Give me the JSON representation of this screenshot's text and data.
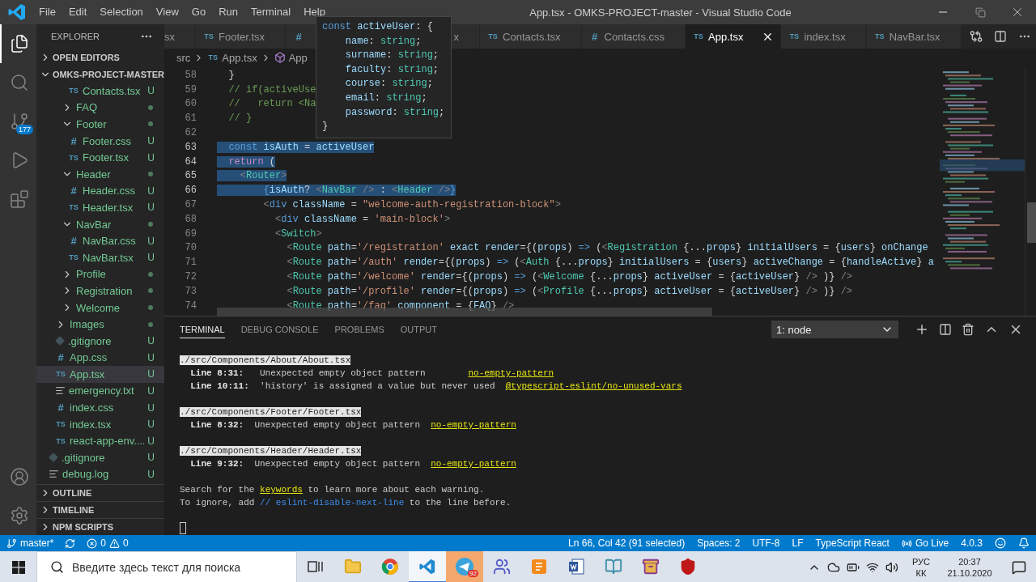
{
  "title_bar": {
    "menu": [
      "File",
      "Edit",
      "Selection",
      "View",
      "Go",
      "Run",
      "Terminal",
      "Help"
    ],
    "title": "App.tsx - OMKS-PROJECT-master - Visual Studio Code"
  },
  "activity_bar": {
    "items": [
      {
        "kind": "explorer",
        "selected": true
      },
      {
        "kind": "search",
        "selected": false
      },
      {
        "kind": "source-control",
        "selected": false,
        "badge": "177"
      },
      {
        "kind": "run",
        "selected": false
      },
      {
        "kind": "extensions",
        "selected": false
      }
    ],
    "bottom": [
      {
        "kind": "account"
      },
      {
        "kind": "settings"
      }
    ]
  },
  "explorer": {
    "title": "EXPLORER",
    "sections_top": [
      {
        "label": "OPEN EDITORS",
        "expanded": false
      },
      {
        "label": "OMKS-PROJECT-MASTER",
        "expanded": true
      }
    ],
    "tree": [
      {
        "children": [
          {
            "children": [
              {
                "children": [
                  {
                    "kind": "ts",
                    "glyph": "TS",
                    "label": "Contacts.tsx",
                    "badge": "U",
                    "selected": false
                  }
                ]
              },
              {
                "kind": "folder",
                "label": "FAQ",
                "expanded": false,
                "modified": true,
                "selected": false
              },
              {
                "kind": "folder",
                "label": "Footer",
                "expanded": true,
                "modified": true,
                "selected": false,
                "children": [
                  {
                    "kind": "css",
                    "glyph": "#",
                    "label": "Footer.css",
                    "badge": "U",
                    "selected": false
                  },
                  {
                    "kind": "ts",
                    "glyph": "TS",
                    "label": "Footer.tsx",
                    "badge": "U",
                    "selected": false
                  }
                ]
              },
              {
                "kind": "folder",
                "label": "Header",
                "expanded": true,
                "modified": true,
                "selected": false,
                "children": [
                  {
                    "kind": "css",
                    "glyph": "#",
                    "label": "Header.css",
                    "badge": "U",
                    "selected": false
                  },
                  {
                    "kind": "ts",
                    "glyph": "TS",
                    "label": "Header.tsx",
                    "badge": "U",
                    "selected": false
                  }
                ]
              },
              {
                "kind": "folder",
                "label": "NavBar",
                "expanded": true,
                "modified": true,
                "selected": false,
                "children": [
                  {
                    "kind": "css",
                    "glyph": "#",
                    "label": "NavBar.css",
                    "badge": "U",
                    "selected": false
                  },
                  {
                    "kind": "ts",
                    "glyph": "TS",
                    "label": "NavBar.tsx",
                    "badge": "U",
                    "selected": false
                  }
                ]
              },
              {
                "kind": "folder",
                "label": "Profile",
                "expanded": false,
                "modified": true,
                "selected": false
              },
              {
                "kind": "folder",
                "label": "Registration",
                "expanded": false,
                "modified": true,
                "selected": false
              },
              {
                "kind": "folder",
                "label": "Welcome",
                "expanded": false,
                "modified": true,
                "selected": false
              }
            ]
          },
          {
            "kind": "folder",
            "label": "Images",
            "expanded": false,
            "modified": true,
            "selected": false
          },
          {
            "kind": "git",
            "label": ".gitignore",
            "badge": "U",
            "selected": false
          },
          {
            "kind": "css",
            "glyph": "#",
            "label": "App.css",
            "badge": "U",
            "selected": false
          },
          {
            "kind": "ts",
            "glyph": "TS",
            "label": "App.tsx",
            "badge": "U",
            "selected": true
          },
          {
            "kind": "txt",
            "label": "emergency.txt",
            "badge": "U",
            "selected": false
          },
          {
            "kind": "css",
            "glyph": "#",
            "label": "index.css",
            "badge": "U",
            "selected": false
          },
          {
            "kind": "ts",
            "glyph": "TS",
            "label": "index.tsx",
            "badge": "U",
            "selected": false
          },
          {
            "kind": "ts",
            "glyph": "TS",
            "label": "react-app-env....",
            "badge": "U",
            "selected": false
          }
        ]
      },
      {
        "kind": "git",
        "label": ".gitignore",
        "badge": "U",
        "selected": false
      },
      {
        "kind": "txt",
        "label": "debug.log",
        "badge": "U",
        "selected": false
      }
    ],
    "sections_bottom": [
      {
        "label": "OUTLINE",
        "expanded": false
      },
      {
        "label": "TIMELINE",
        "expanded": false
      },
      {
        "label": "NPM SCRIPTS",
        "expanded": false
      }
    ]
  },
  "editor": {
    "tabs": [
      {
        "label": "sx",
        "selected": false,
        "cut": true
      },
      {
        "glyph": "TS",
        "kind": "ts",
        "label": "Footer.tsx",
        "selected": false
      },
      {
        "glyph": "#",
        "kind": "css",
        "label": "x",
        "selected": false,
        "covered": true
      },
      {
        "glyph": "TS",
        "kind": "ts",
        "label": "Contacts.tsx",
        "selected": false
      },
      {
        "glyph": "#",
        "kind": "css",
        "label": "Contacts.css",
        "selected": false
      },
      {
        "glyph": "TS",
        "kind": "ts",
        "label": "App.tsx",
        "selected": true
      },
      {
        "glyph": "TS",
        "kind": "ts",
        "label": "index.tsx",
        "selected": false
      },
      {
        "glyph": "TS",
        "kind": "ts",
        "label": "NavBar.tsx",
        "selected": false
      }
    ],
    "breadcrumbs": [
      {
        "kind": "folder",
        "label": "src"
      },
      {
        "kind": "file",
        "glyph": "TS",
        "label": "App.tsx"
      },
      {
        "kind": "symbol",
        "label": "App"
      }
    ],
    "lines": [
      {
        "number": "58",
        "selected": false,
        "tokens": [
          {
            "kind": "p",
            "text": "  }"
          }
        ]
      },
      {
        "number": "59",
        "selected": false,
        "tokens": [
          {
            "kind": "comment",
            "text": "  // if(activeUse"
          }
        ]
      },
      {
        "number": "60",
        "selected": false,
        "tokens": [
          {
            "kind": "comment",
            "text": "  //   return <Na"
          }
        ]
      },
      {
        "number": "61",
        "selected": false,
        "tokens": [
          {
            "kind": "comment",
            "text": "  // }"
          }
        ]
      },
      {
        "number": "62",
        "selected": false
      },
      {
        "number": "63",
        "selected": true,
        "tokens": [
          {
            "kind": "kw",
            "text": "  const"
          },
          {
            "kind": "var",
            "text": " isAuth"
          },
          {
            "kind": "p",
            "text": " = "
          },
          {
            "kind": "var",
            "text": "activeUser"
          }
        ]
      },
      {
        "number": "64",
        "selected": true,
        "tokens": [
          {
            "kind": "ctl",
            "text": "  return"
          },
          {
            "kind": "p",
            "text": " ("
          }
        ]
      },
      {
        "number": "65",
        "selected": true,
        "tokens": [
          {
            "kind": "punct",
            "text": "    <"
          },
          {
            "kind": "tag",
            "text": "Router"
          },
          {
            "kind": "punct",
            "text": ">"
          }
        ]
      },
      {
        "number": "66",
        "selected": true,
        "tokens": [
          {
            "kind": "kw",
            "text": "        {"
          },
          {
            "kind": "var",
            "text": "isAuth"
          },
          {
            "kind": "p",
            "text": "? "
          },
          {
            "kind": "punct",
            "text": "<"
          },
          {
            "kind": "tag",
            "text": "NavBar"
          },
          {
            "kind": "punct",
            "text": " />"
          },
          {
            "kind": "p",
            "text": " : "
          },
          {
            "kind": "punct",
            "text": "<"
          },
          {
            "kind": "tag",
            "text": "Header"
          },
          {
            "kind": "punct",
            "text": " />"
          },
          {
            "kind": "kw",
            "text": "}"
          }
        ]
      },
      {
        "number": "67",
        "selected": false,
        "tokens": [
          {
            "kind": "punct",
            "text": "        <"
          },
          {
            "kind": "html",
            "text": "div"
          },
          {
            "kind": "attr",
            "text": " className"
          },
          {
            "kind": "p",
            "text": " = "
          },
          {
            "kind": "str",
            "text": "\"welcome-auth-registration-block\""
          },
          {
            "kind": "punct",
            "text": ">"
          }
        ]
      },
      {
        "number": "68",
        "selected": false,
        "tokens": [
          {
            "kind": "punct",
            "text": "          <"
          },
          {
            "kind": "html",
            "text": "div"
          },
          {
            "kind": "attr",
            "text": " className"
          },
          {
            "kind": "p",
            "text": " = "
          },
          {
            "kind": "str",
            "text": "'main-block'"
          },
          {
            "kind": "punct",
            "text": ">"
          }
        ]
      },
      {
        "number": "69",
        "selected": false,
        "tokens": [
          {
            "kind": "punct",
            "text": "          <"
          },
          {
            "kind": "tag",
            "text": "Switch"
          },
          {
            "kind": "punct",
            "text": ">"
          }
        ]
      },
      {
        "number": "70",
        "selected": false,
        "tokens": [
          {
            "kind": "punct",
            "text": "            <"
          },
          {
            "kind": "tag",
            "text": "Route"
          },
          {
            "kind": "attr",
            "text": " path"
          },
          {
            "kind": "p",
            "text": "="
          },
          {
            "kind": "str",
            "text": "'/registration'"
          },
          {
            "kind": "attr",
            "text": " exact"
          },
          {
            "kind": "attr",
            "text": " render"
          },
          {
            "kind": "p",
            "text": "={("
          },
          {
            "kind": "var",
            "text": "props"
          },
          {
            "kind": "p",
            "text": ") "
          },
          {
            "kind": "kw",
            "text": "=>"
          },
          {
            "kind": "p",
            "text": " ("
          },
          {
            "kind": "punct",
            "text": "<"
          },
          {
            "kind": "tag",
            "text": "Registration"
          },
          {
            "kind": "p",
            "text": " {..."
          },
          {
            "kind": "var",
            "text": "props"
          },
          {
            "kind": "p",
            "text": "} "
          },
          {
            "kind": "attr",
            "text": "initialUsers"
          },
          {
            "kind": "p",
            "text": " = {"
          },
          {
            "kind": "var",
            "text": "users"
          },
          {
            "kind": "p",
            "text": "} "
          },
          {
            "kind": "attr",
            "text": "onChange"
          }
        ]
      },
      {
        "number": "71",
        "selected": false,
        "tokens": [
          {
            "kind": "punct",
            "text": "            <"
          },
          {
            "kind": "tag",
            "text": "Route"
          },
          {
            "kind": "attr",
            "text": " path"
          },
          {
            "kind": "p",
            "text": "="
          },
          {
            "kind": "str",
            "text": "'/auth'"
          },
          {
            "kind": "attr",
            "text": " render"
          },
          {
            "kind": "p",
            "text": "={("
          },
          {
            "kind": "var",
            "text": "props"
          },
          {
            "kind": "p",
            "text": ") "
          },
          {
            "kind": "kw",
            "text": "=>"
          },
          {
            "kind": "p",
            "text": " ("
          },
          {
            "kind": "punct",
            "text": "<"
          },
          {
            "kind": "tag",
            "text": "Auth"
          },
          {
            "kind": "p",
            "text": " {..."
          },
          {
            "kind": "var",
            "text": "props"
          },
          {
            "kind": "p",
            "text": "} "
          },
          {
            "kind": "attr",
            "text": "initialUsers"
          },
          {
            "kind": "p",
            "text": " = {"
          },
          {
            "kind": "var",
            "text": "users"
          },
          {
            "kind": "p",
            "text": "} "
          },
          {
            "kind": "attr",
            "text": "activeChange"
          },
          {
            "kind": "p",
            "text": " = {"
          },
          {
            "kind": "var",
            "text": "handleActive"
          },
          {
            "kind": "p",
            "text": "} "
          },
          {
            "kind": "attr",
            "text": "a"
          }
        ]
      },
      {
        "number": "72",
        "selected": false,
        "tokens": [
          {
            "kind": "punct",
            "text": "            <"
          },
          {
            "kind": "tag",
            "text": "Route"
          },
          {
            "kind": "attr",
            "text": " path"
          },
          {
            "kind": "p",
            "text": "="
          },
          {
            "kind": "str",
            "text": "'/welcome'"
          },
          {
            "kind": "attr",
            "text": " render"
          },
          {
            "kind": "p",
            "text": "={("
          },
          {
            "kind": "var",
            "text": "props"
          },
          {
            "kind": "p",
            "text": ") "
          },
          {
            "kind": "kw",
            "text": "=>"
          },
          {
            "kind": "p",
            "text": " ("
          },
          {
            "kind": "punct",
            "text": "<"
          },
          {
            "kind": "tag",
            "text": "Welcome"
          },
          {
            "kind": "p",
            "text": " {..."
          },
          {
            "kind": "var",
            "text": "props"
          },
          {
            "kind": "p",
            "text": "} "
          },
          {
            "kind": "attr",
            "text": "activeUser"
          },
          {
            "kind": "p",
            "text": " = {"
          },
          {
            "kind": "var",
            "text": "activeUser"
          },
          {
            "kind": "p",
            "text": "} "
          },
          {
            "kind": "punct",
            "text": "/>"
          },
          {
            "kind": "p",
            "text": " )} "
          },
          {
            "kind": "punct",
            "text": "/>"
          }
        ]
      },
      {
        "number": "73",
        "selected": false,
        "tokens": [
          {
            "kind": "punct",
            "text": "            <"
          },
          {
            "kind": "tag",
            "text": "Route"
          },
          {
            "kind": "attr",
            "text": " path"
          },
          {
            "kind": "p",
            "text": "="
          },
          {
            "kind": "str",
            "text": "'/profile'"
          },
          {
            "kind": "attr",
            "text": " render"
          },
          {
            "kind": "p",
            "text": "={("
          },
          {
            "kind": "var",
            "text": "props"
          },
          {
            "kind": "p",
            "text": ") "
          },
          {
            "kind": "kw",
            "text": "=>"
          },
          {
            "kind": "p",
            "text": " ("
          },
          {
            "kind": "punct",
            "text": "<"
          },
          {
            "kind": "tag",
            "text": "Profile"
          },
          {
            "kind": "p",
            "text": " {..."
          },
          {
            "kind": "var",
            "text": "props"
          },
          {
            "kind": "p",
            "text": "} "
          },
          {
            "kind": "attr",
            "text": "activeUser"
          },
          {
            "kind": "p",
            "text": " = {"
          },
          {
            "kind": "var",
            "text": "activeUser"
          },
          {
            "kind": "p",
            "text": "} "
          },
          {
            "kind": "punct",
            "text": "/>"
          },
          {
            "kind": "p",
            "text": " )} "
          },
          {
            "kind": "punct",
            "text": "/>"
          }
        ]
      },
      {
        "number": "74",
        "selected": false,
        "tokens": [
          {
            "kind": "punct",
            "text": "            <"
          },
          {
            "kind": "tag",
            "text": "Route"
          },
          {
            "kind": "attr",
            "text": " path"
          },
          {
            "kind": "p",
            "text": "="
          },
          {
            "kind": "str",
            "text": "'/faq'"
          },
          {
            "kind": "attr",
            "text": " component"
          },
          {
            "kind": "p",
            "text": " = {"
          },
          {
            "kind": "var",
            "text": "FAQ"
          },
          {
            "kind": "p",
            "text": "} "
          },
          {
            "kind": "punct",
            "text": "/>"
          }
        ]
      }
    ],
    "hover": {
      "lines": [
        [
          {
            "kind": "kw",
            "text": "const"
          },
          {
            "kind": "var",
            "text": " activeUser"
          },
          {
            "kind": "p",
            "text": ": {"
          }
        ],
        [
          {
            "kind": "var",
            "text": "    name"
          },
          {
            "kind": "p",
            "text": ": "
          },
          {
            "kind": "type",
            "text": "string"
          },
          {
            "kind": "p",
            "text": ";"
          }
        ],
        [
          {
            "kind": "var",
            "text": "    surname"
          },
          {
            "kind": "p",
            "text": ": "
          },
          {
            "kind": "type",
            "text": "string"
          },
          {
            "kind": "p",
            "text": ";"
          }
        ],
        [
          {
            "kind": "var",
            "text": "    faculty"
          },
          {
            "kind": "p",
            "text": ": "
          },
          {
            "kind": "type",
            "text": "string"
          },
          {
            "kind": "p",
            "text": ";"
          }
        ],
        [
          {
            "kind": "var",
            "text": "    course"
          },
          {
            "kind": "p",
            "text": ": "
          },
          {
            "kind": "type",
            "text": "string"
          },
          {
            "kind": "p",
            "text": ";"
          }
        ],
        [
          {
            "kind": "var",
            "text": "    email"
          },
          {
            "kind": "p",
            "text": ": "
          },
          {
            "kind": "type",
            "text": "string"
          },
          {
            "kind": "p",
            "text": ";"
          }
        ],
        [
          {
            "kind": "var",
            "text": "    password"
          },
          {
            "kind": "p",
            "text": ": "
          },
          {
            "kind": "type",
            "text": "string"
          },
          {
            "kind": "p",
            "text": ";"
          }
        ],
        [
          {
            "kind": "p",
            "text": "}"
          }
        ]
      ]
    }
  },
  "panel": {
    "tabs": [
      {
        "label": "TERMINAL",
        "selected": true
      },
      {
        "label": "DEBUG CONSOLE",
        "selected": false
      },
      {
        "label": "PROBLEMS",
        "selected": false
      },
      {
        "label": "OUTPUT",
        "selected": false
      }
    ],
    "terminal_select": "1: node",
    "blocks": [
      [
        [
          {
            "kind": "file",
            "text": "./src/Components/About/About.tsx"
          }
        ],
        [
          {
            "kind": "bold",
            "text": "  Line 8:31:"
          },
          {
            "kind": "text",
            "text": "   Unexpected empty object pattern        "
          },
          {
            "kind": "rule",
            "text": "no-empty-pattern"
          }
        ],
        [
          {
            "kind": "bold",
            "text": "  Line 10:11:"
          },
          {
            "kind": "text",
            "text": "  'history' is assigned a value but never used  "
          },
          {
            "kind": "rule",
            "text": "@typescript-eslint/no-unused-vars"
          }
        ]
      ],
      [
        [
          {
            "kind": "file",
            "text": "./src/Components/Footer/Footer.tsx"
          }
        ],
        [
          {
            "kind": "bold",
            "text": "  Line 8:32:"
          },
          {
            "kind": "text",
            "text": "  Unexpected empty object pattern  "
          },
          {
            "kind": "rule",
            "text": "no-empty-pattern"
          }
        ]
      ],
      [
        [
          {
            "kind": "file",
            "text": "./src/Components/Header/Header.tsx"
          }
        ],
        [
          {
            "kind": "bold",
            "text": "  Line 9:32:"
          },
          {
            "kind": "text",
            "text": "  Unexpected empty object pattern  "
          },
          {
            "kind": "rule",
            "text": "no-empty-pattern"
          }
        ]
      ],
      [
        [
          {
            "kind": "text",
            "text": "Search for the "
          },
          {
            "kind": "rule",
            "text": "keywords"
          },
          {
            "kind": "text",
            "text": " to learn more about each warning."
          }
        ],
        [
          {
            "kind": "text",
            "text": "To ignore, add "
          },
          {
            "kind": "comment",
            "text": "// eslint-disable-next-line"
          },
          {
            "kind": "text",
            "text": " to the line before."
          }
        ]
      ]
    ],
    "cursor_visible": true
  },
  "status_bar": {
    "branch": "master*",
    "errors": "0",
    "warnings": "0",
    "right": [
      {
        "kind": "text",
        "label": "Ln 66, Col 42 (91 selected)"
      },
      {
        "kind": "text",
        "label": "Spaces: 2"
      },
      {
        "kind": "text",
        "label": "UTF-8"
      },
      {
        "kind": "text",
        "label": "LF"
      },
      {
        "kind": "text",
        "label": "TypeScript React"
      },
      {
        "kind": "live",
        "label": "Go Live"
      },
      {
        "kind": "text",
        "label": "4.0.3"
      },
      {
        "kind": "feedback"
      },
      {
        "kind": "bell"
      }
    ]
  },
  "taskbar": {
    "search_placeholder": "Введите здесь текст для поиска",
    "apps": [
      {
        "kind": "taskview",
        "selected": false,
        "alert": false
      },
      {
        "kind": "folder",
        "selected": false,
        "alert": false
      },
      {
        "kind": "browser",
        "selected": false,
        "alert": false
      },
      {
        "kind": "code",
        "selected": true,
        "alert": false
      },
      {
        "kind": "telegram",
        "selected": false,
        "alert": true,
        "badge": "92"
      },
      {
        "kind": "teams",
        "selected": false,
        "alert": false
      },
      {
        "kind": "pdf",
        "selected": false,
        "alert": false
      },
      {
        "kind": "word",
        "selected": false,
        "alert": false
      },
      {
        "kind": "notebook",
        "selected": false,
        "alert": false
      },
      {
        "kind": "archive",
        "selected": false,
        "alert": false
      },
      {
        "kind": "shield",
        "selected": false,
        "alert": false
      }
    ],
    "tray": {
      "language": "РУС",
      "layout": "КК",
      "time": "20:37",
      "date": "21.10.2020"
    }
  }
}
